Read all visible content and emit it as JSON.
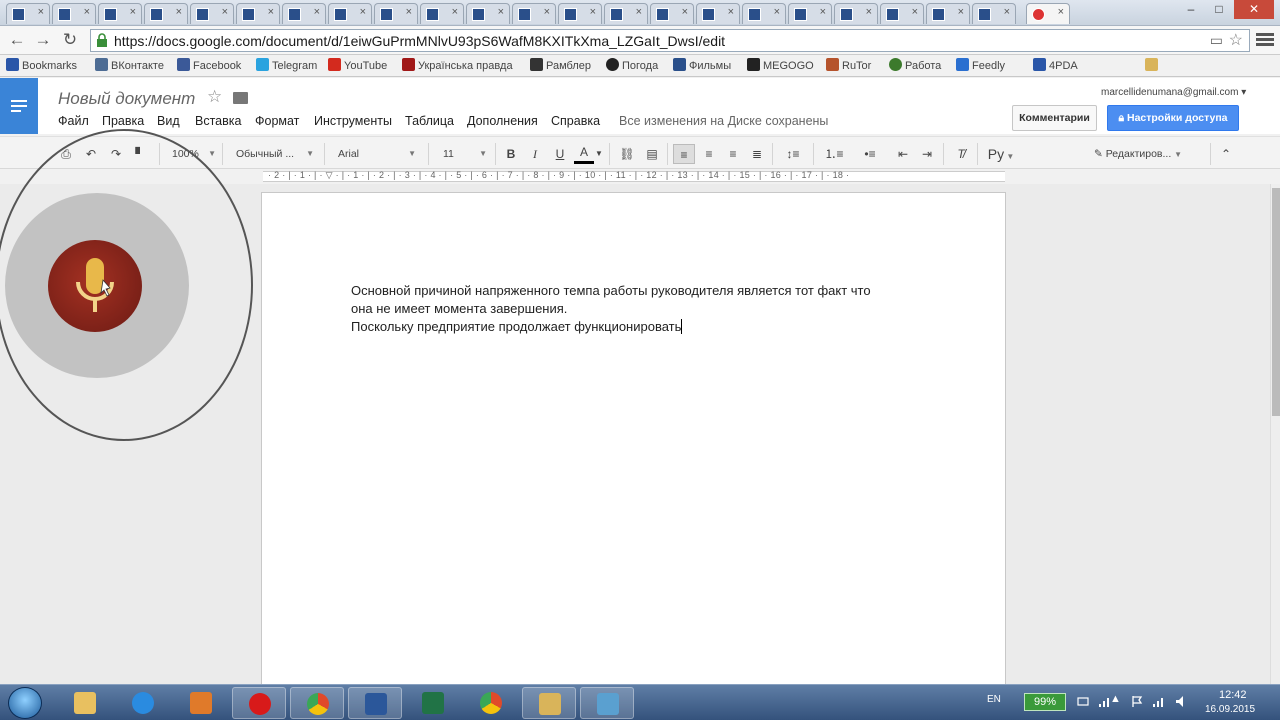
{
  "browser": {
    "url": "https://docs.google.com/document/d/1eiwGuPrmMNlvU93pS6WafM8KXITkXma_LZGaIt_DwsI/edit"
  },
  "bookmarks": [
    {
      "label": "Bookmarks",
      "color": "#2a56a8"
    },
    {
      "label": "ВКонтакте",
      "color": "#4d6c94"
    },
    {
      "label": "Facebook",
      "color": "#3b5998"
    },
    {
      "label": "Telegram",
      "color": "#2aa3df"
    },
    {
      "label": "YouTube",
      "color": "#d32a1e"
    },
    {
      "label": "Українська правда",
      "color": "#a01818"
    },
    {
      "label": "Рамблер",
      "color": "#333333"
    },
    {
      "label": "Погода",
      "color": "#222222"
    },
    {
      "label": "Фильмы",
      "color": "#2a4f8a"
    },
    {
      "label": "MEGOGO",
      "color": "#222222"
    },
    {
      "label": "RuTor",
      "color": "#b5532c"
    },
    {
      "label": "Работа",
      "color": "#3c7a2c"
    },
    {
      "label": "Feedly",
      "color": "#2a6fd0"
    },
    {
      "label": "4PDA",
      "color": "#2a56a8"
    }
  ],
  "docs": {
    "title": "Новый документ",
    "menu": [
      "Файл",
      "Правка",
      "Вид",
      "Вставка",
      "Формат",
      "Инструменты",
      "Таблица",
      "Дополнения",
      "Справка"
    ],
    "saved_status": "Все изменения на Диске сохранены",
    "user_email": "marcellidenumana@gmail.com",
    "comments_label": "Комментарии",
    "share_label": "Настройки доступа"
  },
  "toolbar": {
    "zoom": "100%",
    "style": "Обычный ...",
    "font": "Arial",
    "font_size": "11",
    "bold": "B",
    "italic": "I",
    "underline": "U",
    "text_color": "A",
    "input_tools": "Ру",
    "mode": "Редактиров..."
  },
  "ruler": {
    "numbers": "· 2 · | · 1 · | · ▽ · | · 1 · | · 2 · | · 3 · | · 4 · | · 5 · | · 6 · | · 7 · | · 8 · | · 9 · | · 10 · | · 11 · | · 12 · | · 13 · | · 14 · | · 15 · | · 16 · | · 17 · | · 18 ·"
  },
  "document": {
    "lines": [
      "Основной причиной напряженного темпа работы руководителя является тот факт что",
      "она не имеет момента завершения.",
      "Поскольку предприятие продолжает функционировать"
    ]
  },
  "taskbar": {
    "apps": [
      {
        "name": "folders",
        "color": "#e8c060"
      },
      {
        "name": "ie",
        "color": "#2a8be0"
      },
      {
        "name": "media",
        "color": "#e07a2a"
      },
      {
        "name": "opera",
        "color": "#d81a1a"
      },
      {
        "name": "chrome",
        "color": "#e04a2a"
      },
      {
        "name": "word",
        "color": "#2b579a"
      },
      {
        "name": "excel",
        "color": "#217346"
      },
      {
        "name": "chrome-2",
        "color": "#e04a2a"
      },
      {
        "name": "explorer",
        "color": "#d9b45a"
      },
      {
        "name": "network",
        "color": "#5aa0d0"
      }
    ],
    "language": "EN",
    "battery": "99%",
    "time": "12:42",
    "date": "16.09.2015"
  }
}
